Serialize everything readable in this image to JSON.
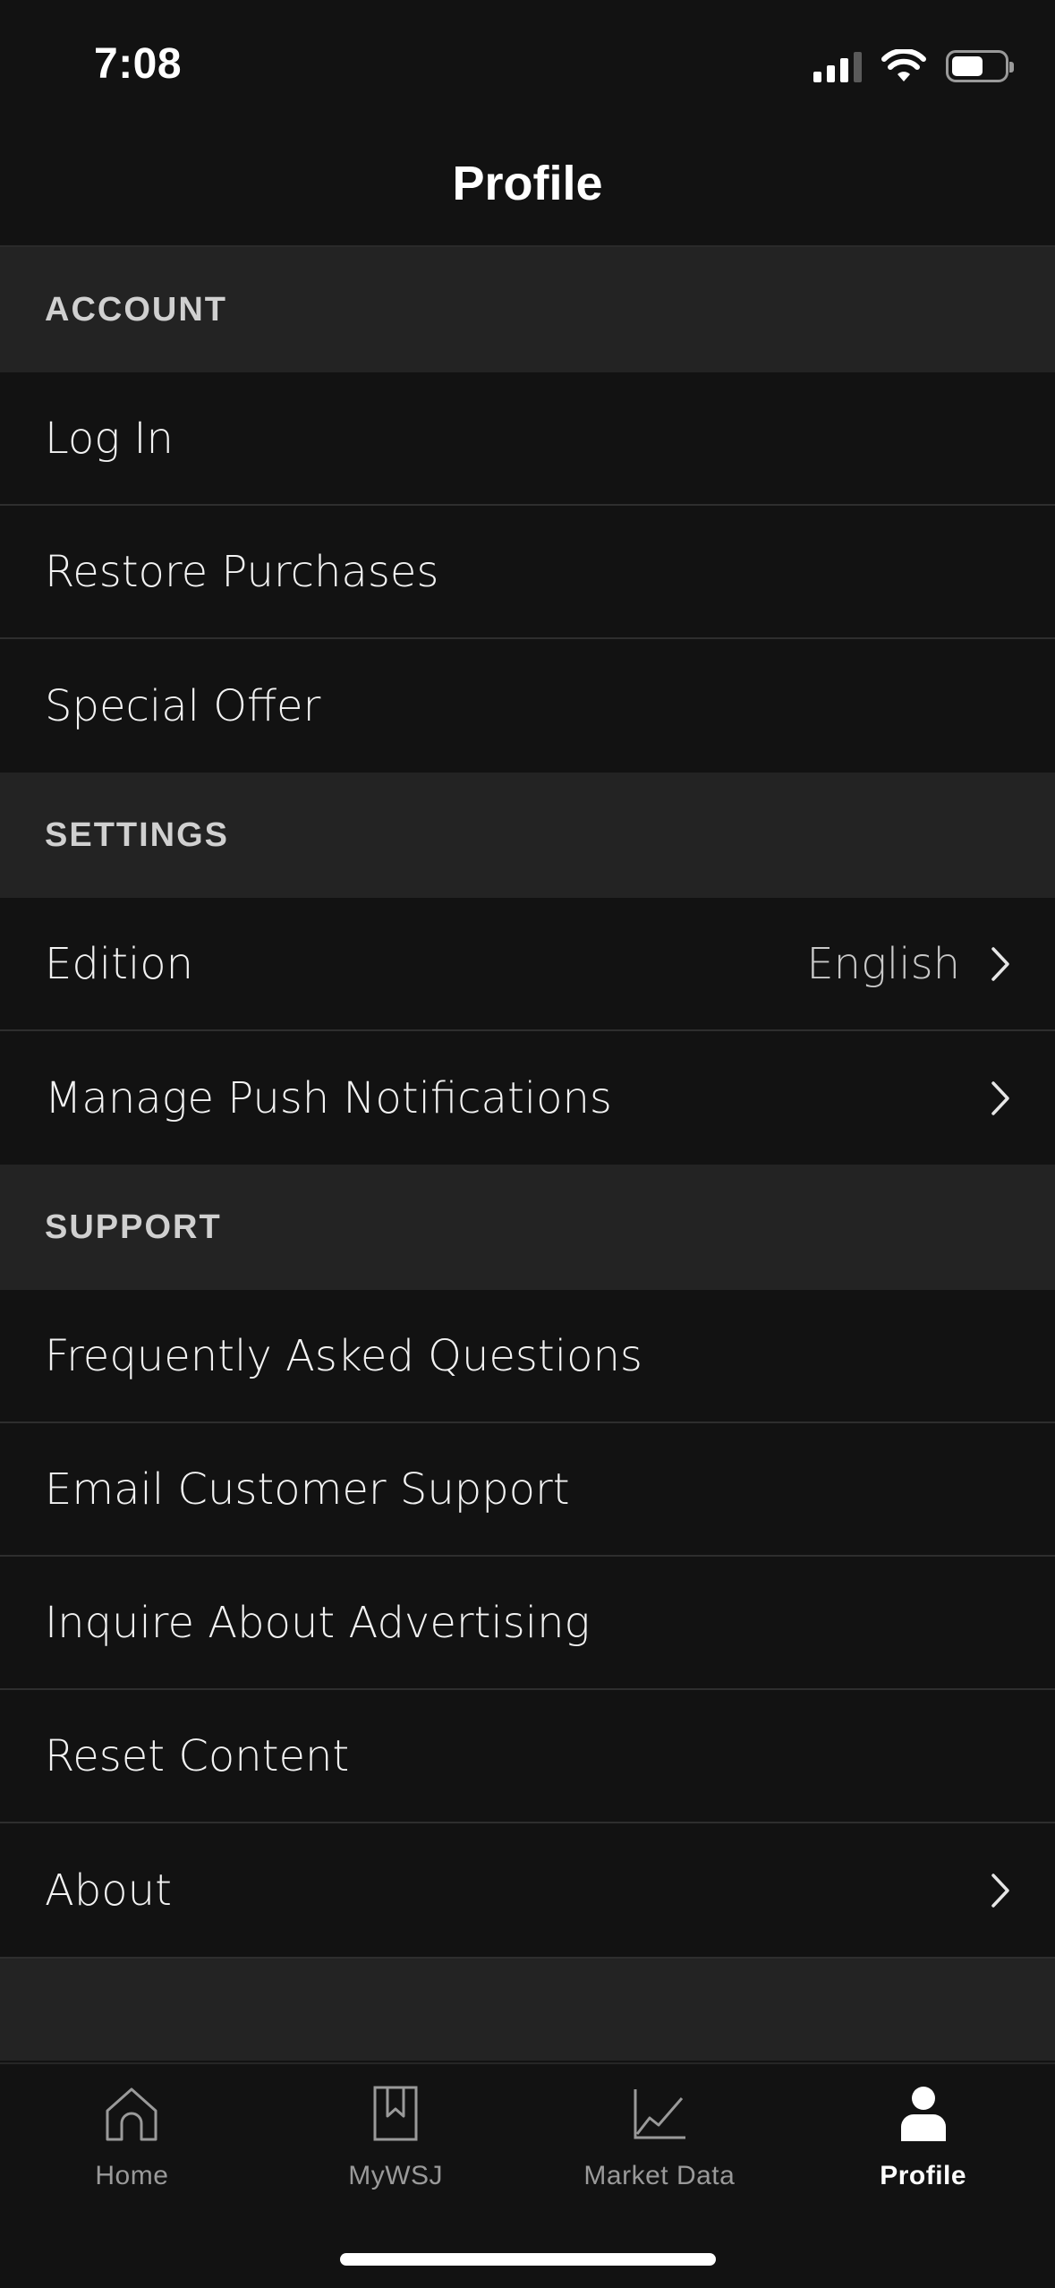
{
  "status_bar": {
    "time": "7:08"
  },
  "nav": {
    "title": "Profile"
  },
  "sections": [
    {
      "header": "ACCOUNT",
      "rows": [
        {
          "label": "Log In"
        },
        {
          "label": "Restore Purchases"
        },
        {
          "label": "Special Offer"
        }
      ]
    },
    {
      "header": "SETTINGS",
      "rows": [
        {
          "label": "Edition",
          "value": "English",
          "chevron": true
        },
        {
          "label": "Manage Push Notifications",
          "chevron": true
        }
      ]
    },
    {
      "header": "SUPPORT",
      "rows": [
        {
          "label": "Frequently Asked Questions"
        },
        {
          "label": "Email Customer Support"
        },
        {
          "label": "Inquire About Advertising"
        },
        {
          "label": "Reset Content"
        },
        {
          "label": "About",
          "chevron": true
        }
      ]
    }
  ],
  "tab_bar": {
    "tabs": [
      {
        "label": "Home",
        "icon": "home-icon",
        "active": false
      },
      {
        "label": "MyWSJ",
        "icon": "bookmark-icon",
        "active": false
      },
      {
        "label": "Market Data",
        "icon": "chart-icon",
        "active": false
      },
      {
        "label": "Profile",
        "icon": "person-icon",
        "active": true
      }
    ]
  },
  "colors": {
    "background": "#121212",
    "section_header_bg": "#232323",
    "divider": "#2e2e2e",
    "active_tab": "#ffffff",
    "inactive_tab": "#9a9a9a"
  }
}
